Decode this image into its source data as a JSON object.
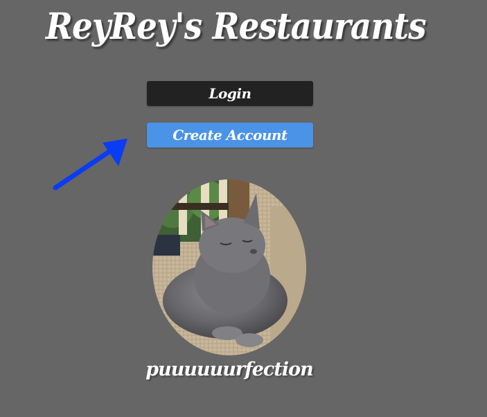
{
  "header": {
    "title": "ReyRey's Restaurants"
  },
  "actions": {
    "login_label": "Login",
    "create_account_label": "Create Account"
  },
  "annotation": {
    "icon": "arrow-pointer-icon",
    "color": "#0a3cf5"
  },
  "profile": {
    "image_subject": "gray cat resting on a woven chair",
    "caption": "puuuuuurfection"
  },
  "theme": {
    "background": "#666666",
    "login_button": "#222222",
    "create_button": "#4a93e6",
    "text": "#ffffff"
  }
}
